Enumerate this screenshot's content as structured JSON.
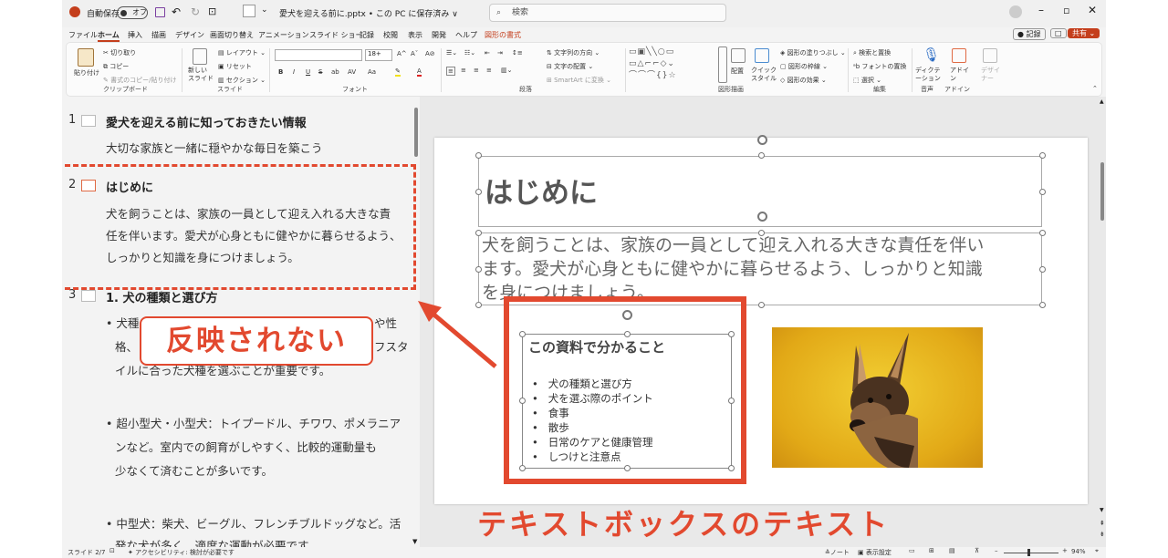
{
  "titlebar": {
    "autosave_label": "自動保存",
    "autosave_state": "オフ",
    "document_title": "愛犬を迎える前に.pptx • この PC に保存済み ∨",
    "search_placeholder": "検索",
    "record_button": "記録",
    "share_button": "共有"
  },
  "menu": [
    "ファイル",
    "ホーム",
    "挿入",
    "描画",
    "デザイン",
    "画面切り替え",
    "アニメーション",
    "スライド ショー",
    "記録",
    "校閲",
    "表示",
    "開発",
    "ヘルプ",
    "図形の書式"
  ],
  "ribbon": {
    "clipboard": {
      "paste": "貼り付け",
      "cut": "切り取り",
      "copy": "コピー",
      "format_painter": "書式のコピー/貼り付け",
      "label": "クリップボード"
    },
    "slides": {
      "new_slide": "新しい スライド",
      "layout": "レイアウト",
      "reset": "リセット",
      "section": "セクション",
      "label": "スライド"
    },
    "font": {
      "size": "18+",
      "label": "フォント",
      "bold": "B",
      "italic": "I",
      "underline": "U",
      "strike": "S",
      "shadow": "ab",
      "spacing": "AV",
      "case": "Aa"
    },
    "paragraph": {
      "text_direction": "文字列の方向",
      "align_text": "文字の配置",
      "smartart": "SmartArt に変換",
      "label": "段落"
    },
    "drawing": {
      "arrange": "配置",
      "quick_styles": "クイック スタイル",
      "fill": "図形の塗りつぶし",
      "outline": "図形の枠線",
      "effects": "図形の効果",
      "label": "図形描画"
    },
    "editing": {
      "find_replace": "検索と置換",
      "replace_font": "フォントの置換",
      "select": "選択",
      "label": "編集"
    },
    "voice": {
      "dictate": "ディクテーション",
      "label": "音声"
    },
    "addins": {
      "addins": "アドイン",
      "label": "アドイン"
    },
    "designer": {
      "designer": "デザイナー"
    }
  },
  "outline": {
    "slides": [
      {
        "num": "1",
        "title": "愛犬を迎える前に知っておきたい情報",
        "lines": [
          "大切な家族と一緒に穏やかな毎日を築こう"
        ]
      },
      {
        "num": "2",
        "title": "はじめに",
        "lines": [
          "犬を飼うことは、家族の一員として迎え入れる大きな責",
          "任を伴います。愛犬が心身ともに健やかに暮らせるよう、",
          "しっかりと知識を身につけましょう。"
        ]
      },
      {
        "num": "3",
        "title": "1. 犬の種類と選び方",
        "lines": [
          "• 犬種",
          "格、",
          "イルに合った犬種を選ぶことが重要です。",
          "",
          "• 超小型犬・小型犬：トイプードル、チワワ、ポメラニア",
          "ンなど。室内での飼育がしやすく、比較的運動量も",
          "少なくて済むことが多いです。",
          "",
          "• 中型犬：柴犬、ビーグル、フレンチブルドッグなど。活",
          "発な犬が多く、適度な運動が必要です。"
        ]
      }
    ],
    "partial_right_1": "や性",
    "partial_right_2": "フスタ"
  },
  "slide": {
    "title": "はじめに",
    "body": [
      "犬を飼うことは、家族の一員として迎え入れる大きな責任を伴い",
      "ます。愛犬が心身ともに健やかに暮らせるよう、しっかりと知識",
      "を身につけましょう。"
    ],
    "textbox_heading": "この資料で分かること",
    "textbox_items": [
      "犬の種類と選び方",
      "犬を選ぶ際のポイント",
      "食事",
      "散歩",
      "日常のケアと健康管理",
      "しつけと注意点"
    ]
  },
  "annotations": {
    "callout": "反映されない",
    "caption": "テキストボックスのテキスト",
    "accent_color": "#e2492f"
  },
  "statusbar": {
    "slide_count": "スライド 2/7",
    "accessibility": "アクセシビリティ: 検討が必要です",
    "notes": "ノート",
    "display_settings": "表示設定",
    "zoom": "94%"
  }
}
